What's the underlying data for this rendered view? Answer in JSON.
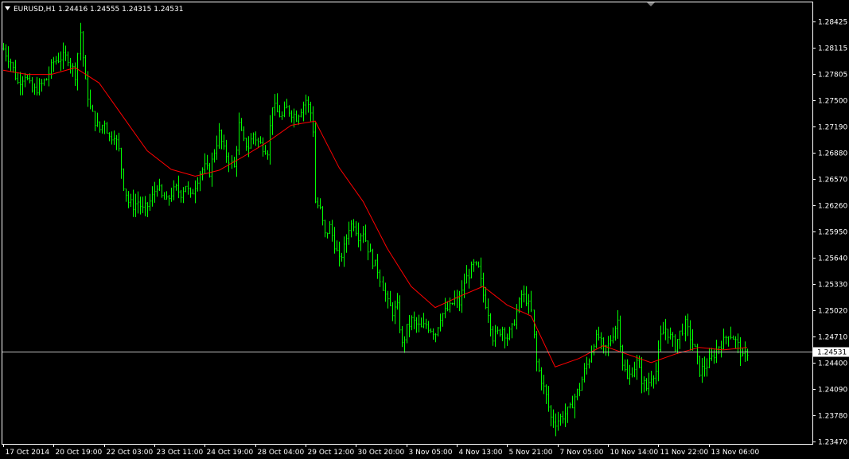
{
  "header": {
    "menu_icon": "triangle-down-icon",
    "text": "EURUSD,H1  1.24416 1.24555 1.24315 1.24531"
  },
  "current_price_label": "1.24531",
  "colors": {
    "background": "#000000",
    "bars": "#00ff00",
    "moving_average": "#ff0000",
    "price_line": "#c0c0c0",
    "axis": "#ffffff",
    "text": "#ffffff"
  },
  "chart_data": {
    "type": "ohlc",
    "symbol": "EURUSD",
    "timeframe": "H1",
    "ylim": [
      1.2347,
      1.2856
    ],
    "current_price": 1.24531,
    "y_ticks": [
      "1.28425",
      "1.28115",
      "1.27805",
      "1.27500",
      "1.27190",
      "1.26880",
      "1.26570",
      "1.26260",
      "1.25950",
      "1.25640",
      "1.25330",
      "1.25020",
      "1.24710",
      "1.24400",
      "1.24090",
      "1.23780",
      "1.23470"
    ],
    "x_ticks": [
      "17 Oct 2014",
      "20 Oct 19:00",
      "22 Oct 03:00",
      "23 Oct 11:00",
      "24 Oct 19:00",
      "28 Oct 04:00",
      "29 Oct 12:00",
      "30 Oct 20:00",
      "3 Nov 05:00",
      "4 Nov 13:00",
      "5 Nov 21:00",
      "7 Nov 05:00",
      "10 Nov 14:00",
      "11 Nov 22:00",
      "13 Nov 06:00"
    ],
    "x_range": [
      0,
      315
    ],
    "x_tick_index": [
      0,
      21,
      42,
      63,
      84,
      105,
      126,
      147,
      168,
      189,
      210,
      231,
      252,
      273,
      294
    ],
    "close_path": [
      [
        0,
        1.281
      ],
      [
        3,
        1.2795
      ],
      [
        6,
        1.277
      ],
      [
        9,
        1.278
      ],
      [
        12,
        1.276
      ],
      [
        15,
        1.2765
      ],
      [
        18,
        1.2775
      ],
      [
        21,
        1.2795
      ],
      [
        24,
        1.28
      ],
      [
        27,
        1.28
      ],
      [
        30,
        1.278
      ],
      [
        32,
        1.283
      ],
      [
        34,
        1.277
      ],
      [
        36,
        1.274
      ],
      [
        38,
        1.2725
      ],
      [
        40,
        1.2715
      ],
      [
        42,
        1.2725
      ],
      [
        44,
        1.2705
      ],
      [
        46,
        1.271
      ],
      [
        48,
        1.269
      ],
      [
        50,
        1.265
      ],
      [
        52,
        1.263
      ],
      [
        54,
        1.2625
      ],
      [
        56,
        1.263
      ],
      [
        58,
        1.262
      ],
      [
        60,
        1.2625
      ],
      [
        62,
        1.2635
      ],
      [
        64,
        1.265
      ],
      [
        66,
        1.2635
      ],
      [
        68,
        1.263
      ],
      [
        70,
        1.264
      ],
      [
        72,
        1.2645
      ],
      [
        74,
        1.264
      ],
      [
        76,
        1.265
      ],
      [
        78,
        1.2635
      ],
      [
        80,
        1.265
      ],
      [
        82,
        1.2665
      ],
      [
        84,
        1.267
      ],
      [
        86,
        1.2665
      ],
      [
        88,
        1.269
      ],
      [
        90,
        1.271
      ],
      [
        92,
        1.269
      ],
      [
        94,
        1.268
      ],
      [
        96,
        1.267
      ],
      [
        98,
        1.272
      ],
      [
        100,
        1.27
      ],
      [
        102,
        1.2695
      ],
      [
        104,
        1.271
      ],
      [
        106,
        1.27
      ],
      [
        108,
        1.2695
      ],
      [
        110,
        1.269
      ],
      [
        112,
        1.2745
      ],
      [
        114,
        1.2735
      ],
      [
        116,
        1.273
      ],
      [
        118,
        1.274
      ],
      [
        120,
        1.2735
      ],
      [
        122,
        1.273
      ],
      [
        124,
        1.274
      ],
      [
        126,
        1.275
      ],
      [
        128,
        1.2735
      ],
      [
        129,
        1.2715
      ],
      [
        130,
        1.263
      ],
      [
        132,
        1.262
      ],
      [
        134,
        1.259
      ],
      [
        136,
        1.26
      ],
      [
        138,
        1.258
      ],
      [
        140,
        1.256
      ],
      [
        142,
        1.2575
      ],
      [
        144,
        1.26
      ],
      [
        146,
        1.2605
      ],
      [
        148,
        1.259
      ],
      [
        150,
        1.2595
      ],
      [
        152,
        1.2575
      ],
      [
        154,
        1.256
      ],
      [
        156,
        1.255
      ],
      [
        158,
        1.253
      ],
      [
        160,
        1.251
      ],
      [
        162,
        1.25
      ],
      [
        164,
        1.2505
      ],
      [
        166,
        1.246
      ],
      [
        168,
        1.248
      ],
      [
        170,
        1.249
      ],
      [
        172,
        1.2485
      ],
      [
        174,
        1.248
      ],
      [
        176,
        1.2485
      ],
      [
        178,
        1.248
      ],
      [
        180,
        1.2475
      ],
      [
        182,
        1.2495
      ],
      [
        184,
        1.25
      ],
      [
        186,
        1.2505
      ],
      [
        188,
        1.2515
      ],
      [
        190,
        1.251
      ],
      [
        192,
        1.2535
      ],
      [
        194,
        1.2545
      ],
      [
        196,
        1.2555
      ],
      [
        198,
        1.255
      ],
      [
        200,
        1.252
      ],
      [
        202,
        1.25
      ],
      [
        204,
        1.247
      ],
      [
        206,
        1.2475
      ],
      [
        208,
        1.248
      ],
      [
        210,
        1.247
      ],
      [
        212,
        1.248
      ],
      [
        214,
        1.25
      ],
      [
        216,
        1.252
      ],
      [
        218,
        1.2515
      ],
      [
        220,
        1.25
      ],
      [
        222,
        1.244
      ],
      [
        224,
        1.242
      ],
      [
        226,
        1.24
      ],
      [
        228,
        1.2375
      ],
      [
        230,
        1.237
      ],
      [
        232,
        1.2375
      ],
      [
        234,
        1.238
      ],
      [
        236,
        1.2385
      ],
      [
        238,
        1.24
      ],
      [
        240,
        1.241
      ],
      [
        242,
        1.243
      ],
      [
        244,
        1.2445
      ],
      [
        246,
        1.2465
      ],
      [
        248,
        1.247
      ],
      [
        250,
        1.2455
      ],
      [
        252,
        1.246
      ],
      [
        254,
        1.2475
      ],
      [
        256,
        1.249
      ],
      [
        258,
        1.244
      ],
      [
        260,
        1.242
      ],
      [
        262,
        1.243
      ],
      [
        264,
        1.244
      ],
      [
        266,
        1.242
      ],
      [
        268,
        1.241
      ],
      [
        270,
        1.2425
      ],
      [
        272,
        1.243
      ],
      [
        274,
        1.247
      ],
      [
        276,
        1.248
      ],
      [
        278,
        1.247
      ],
      [
        280,
        1.246
      ],
      [
        282,
        1.2475
      ],
      [
        284,
        1.2485
      ],
      [
        286,
        1.247
      ],
      [
        288,
        1.2455
      ],
      [
        290,
        1.243
      ],
      [
        292,
        1.2435
      ],
      [
        294,
        1.244
      ],
      [
        296,
        1.245
      ],
      [
        298,
        1.246
      ],
      [
        300,
        1.2465
      ],
      [
        302,
        1.2475
      ],
      [
        304,
        1.247
      ],
      [
        306,
        1.246
      ],
      [
        308,
        1.2445
      ],
      [
        310,
        1.2453
      ]
    ],
    "ma_path": [
      [
        0,
        1.2785
      ],
      [
        10,
        1.278
      ],
      [
        20,
        1.278
      ],
      [
        30,
        1.2788
      ],
      [
        40,
        1.277
      ],
      [
        50,
        1.273
      ],
      [
        60,
        1.269
      ],
      [
        70,
        1.2668
      ],
      [
        80,
        1.266
      ],
      [
        90,
        1.2667
      ],
      [
        100,
        1.2683
      ],
      [
        110,
        1.27
      ],
      [
        120,
        1.272
      ],
      [
        130,
        1.2725
      ],
      [
        140,
        1.267
      ],
      [
        150,
        1.263
      ],
      [
        160,
        1.2575
      ],
      [
        170,
        1.253
      ],
      [
        180,
        1.2505
      ],
      [
        190,
        1.2518
      ],
      [
        200,
        1.253
      ],
      [
        210,
        1.2508
      ],
      [
        220,
        1.2495
      ],
      [
        230,
        1.2435
      ],
      [
        240,
        1.2445
      ],
      [
        250,
        1.246
      ],
      [
        260,
        1.245
      ],
      [
        270,
        1.244
      ],
      [
        280,
        1.245
      ],
      [
        290,
        1.2458
      ],
      [
        300,
        1.2455
      ],
      [
        310,
        1.2458
      ]
    ]
  }
}
